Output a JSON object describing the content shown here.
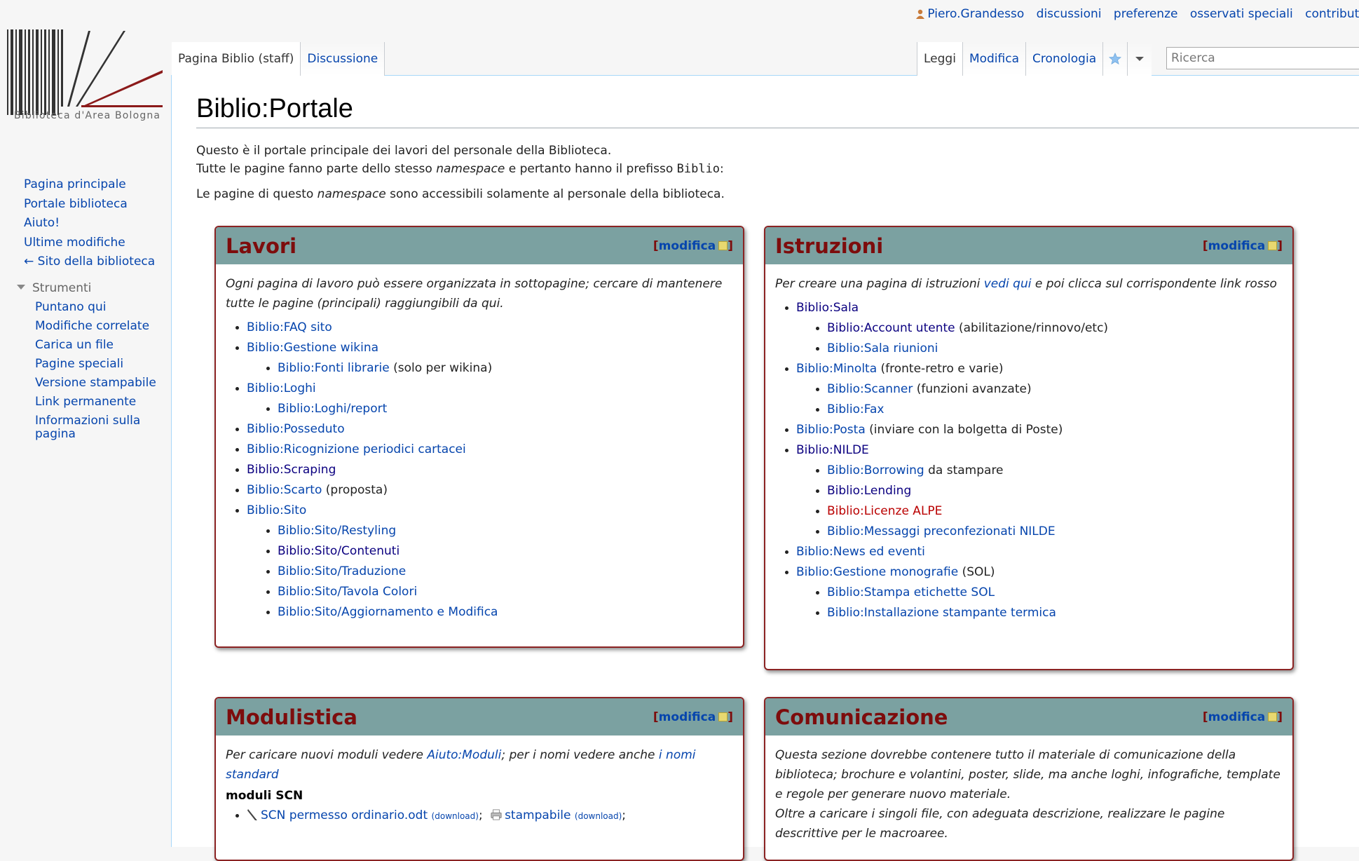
{
  "personal": {
    "user": "Piero.Grandesso",
    "links": [
      "discussioni",
      "preferenze",
      "osservati speciali",
      "contributi"
    ]
  },
  "logo": {
    "caption": "Biblioteca d'Area Bologna"
  },
  "sidebar": {
    "nav": [
      "Pagina principale",
      "Portale biblioteca",
      "Aiuto!",
      "Ultime modifiche",
      "← Sito della biblioteca"
    ],
    "tools_heading": "Strumenti",
    "tools": [
      "Puntano qui",
      "Modifiche correlate",
      "Carica un file",
      "Pagine speciali",
      "Versione stampabile",
      "Link permanente",
      "Informazioni sulla pagina"
    ]
  },
  "tabs": {
    "left": [
      "Pagina Biblio (staff)",
      "Discussione"
    ],
    "right": [
      "Leggi",
      "Modifica",
      "Cronologia"
    ]
  },
  "search": {
    "placeholder": "Ricerca"
  },
  "page": {
    "title": "Biblio:Portale",
    "intro1": "Questo è il portale principale dei lavori del personale della Biblioteca.",
    "intro2a": "Tutte le pagine fanno parte dello stesso ",
    "intro2b": "namespace",
    "intro2c": " e pertanto hanno il prefisso ",
    "intro2d": "Biblio",
    "intro2e": ":",
    "intro3a": "Le pagine di questo ",
    "intro3b": "namespace",
    "intro3c": " sono accessibili solamente al personale della biblioteca."
  },
  "edit": {
    "open": "[",
    "label": "modifica",
    "close": "]"
  },
  "lavori": {
    "title": "Lavori",
    "desc": "Ogni pagina di lavoro può essere organizzata in sottopagine; cercare di mantenere tutte le pagine (principali) raggiungibili da qui.",
    "i1": "Biblio:FAQ sito",
    "i2": "Biblio:Gestione wikina",
    "i2a": "Biblio:Fonti librarie",
    "i2a_note": " (solo per wikina)",
    "i3": "Biblio:Loghi",
    "i3a": "Biblio:Loghi/report",
    "i4": "Biblio:Posseduto",
    "i5": "Biblio:Ricognizione periodici cartacei",
    "i6": "Biblio:Scraping",
    "i7": "Biblio:Scarto",
    "i7_note": " (proposta)",
    "i8": "Biblio:Sito",
    "i8a": "Biblio:Sito/Restyling",
    "i8b": "Biblio:Sito/Contenuti",
    "i8c": "Biblio:Sito/Traduzione",
    "i8d": "Biblio:Sito/Tavola Colori",
    "i8e": "Biblio:Sito/Aggiornamento e Modifica"
  },
  "istruzioni": {
    "title": "Istruzioni",
    "desc_a": "Per creare una pagina di istruzioni ",
    "desc_link": "vedi qui",
    "desc_b": " e poi clicca sul corrispondente link rosso",
    "i1": "Biblio:Sala",
    "i1a": "Biblio:Account utente",
    "i1a_note": " (abilitazione/rinnovo/etc)",
    "i1b": "Biblio:Sala riunioni",
    "i2": "Biblio:Minolta",
    "i2_note": " (fronte-retro e varie)",
    "i2a": "Biblio:Scanner",
    "i2a_note": " (funzioni avanzate)",
    "i2b": "Biblio:Fax",
    "i3": "Biblio:Posta",
    "i3_note": " (inviare con la bolgetta di Poste)",
    "i4": "Biblio:NILDE",
    "i4a": "Biblio:Borrowing",
    "i4a_note": " da stampare",
    "i4b": "Biblio:Lending",
    "i4c": "Biblio:Licenze ALPE",
    "i4d": "Biblio:Messaggi preconfezionati NILDE",
    "i5": "Biblio:News ed eventi",
    "i6": "Biblio:Gestione monografie",
    "i6_note": " (SOL)",
    "i6a": "Biblio:Stampa etichette SOL",
    "i6b": "Biblio:Installazione stampante termica"
  },
  "modulistica": {
    "title": "Modulistica",
    "desc_a": "Per caricare nuovi moduli vedere ",
    "desc_link1": "Aiuto:Moduli",
    "desc_b": "; per i nomi vedere anche ",
    "desc_link2": "i nomi standard",
    "sub": "moduli SCN",
    "file1": "SCN permesso ordinario.odt",
    "file1_dl": "(download)",
    "sep": ";",
    "file2": "stampabile",
    "file2_dl": "(download)",
    "end": ";"
  },
  "comunicazione": {
    "title": "Comunicazione",
    "desc1": "Questa sezione dovrebbe contenere tutto il materiale di comunicazione della biblioteca; brochure e volantini, poster, slide, ma anche loghi, infografiche, template e regole per generare nuovo materiale.",
    "desc2": "Oltre a caricare i singoli file, con adeguata descrizione, realizzare le pagine descrittive per le macroaree."
  }
}
